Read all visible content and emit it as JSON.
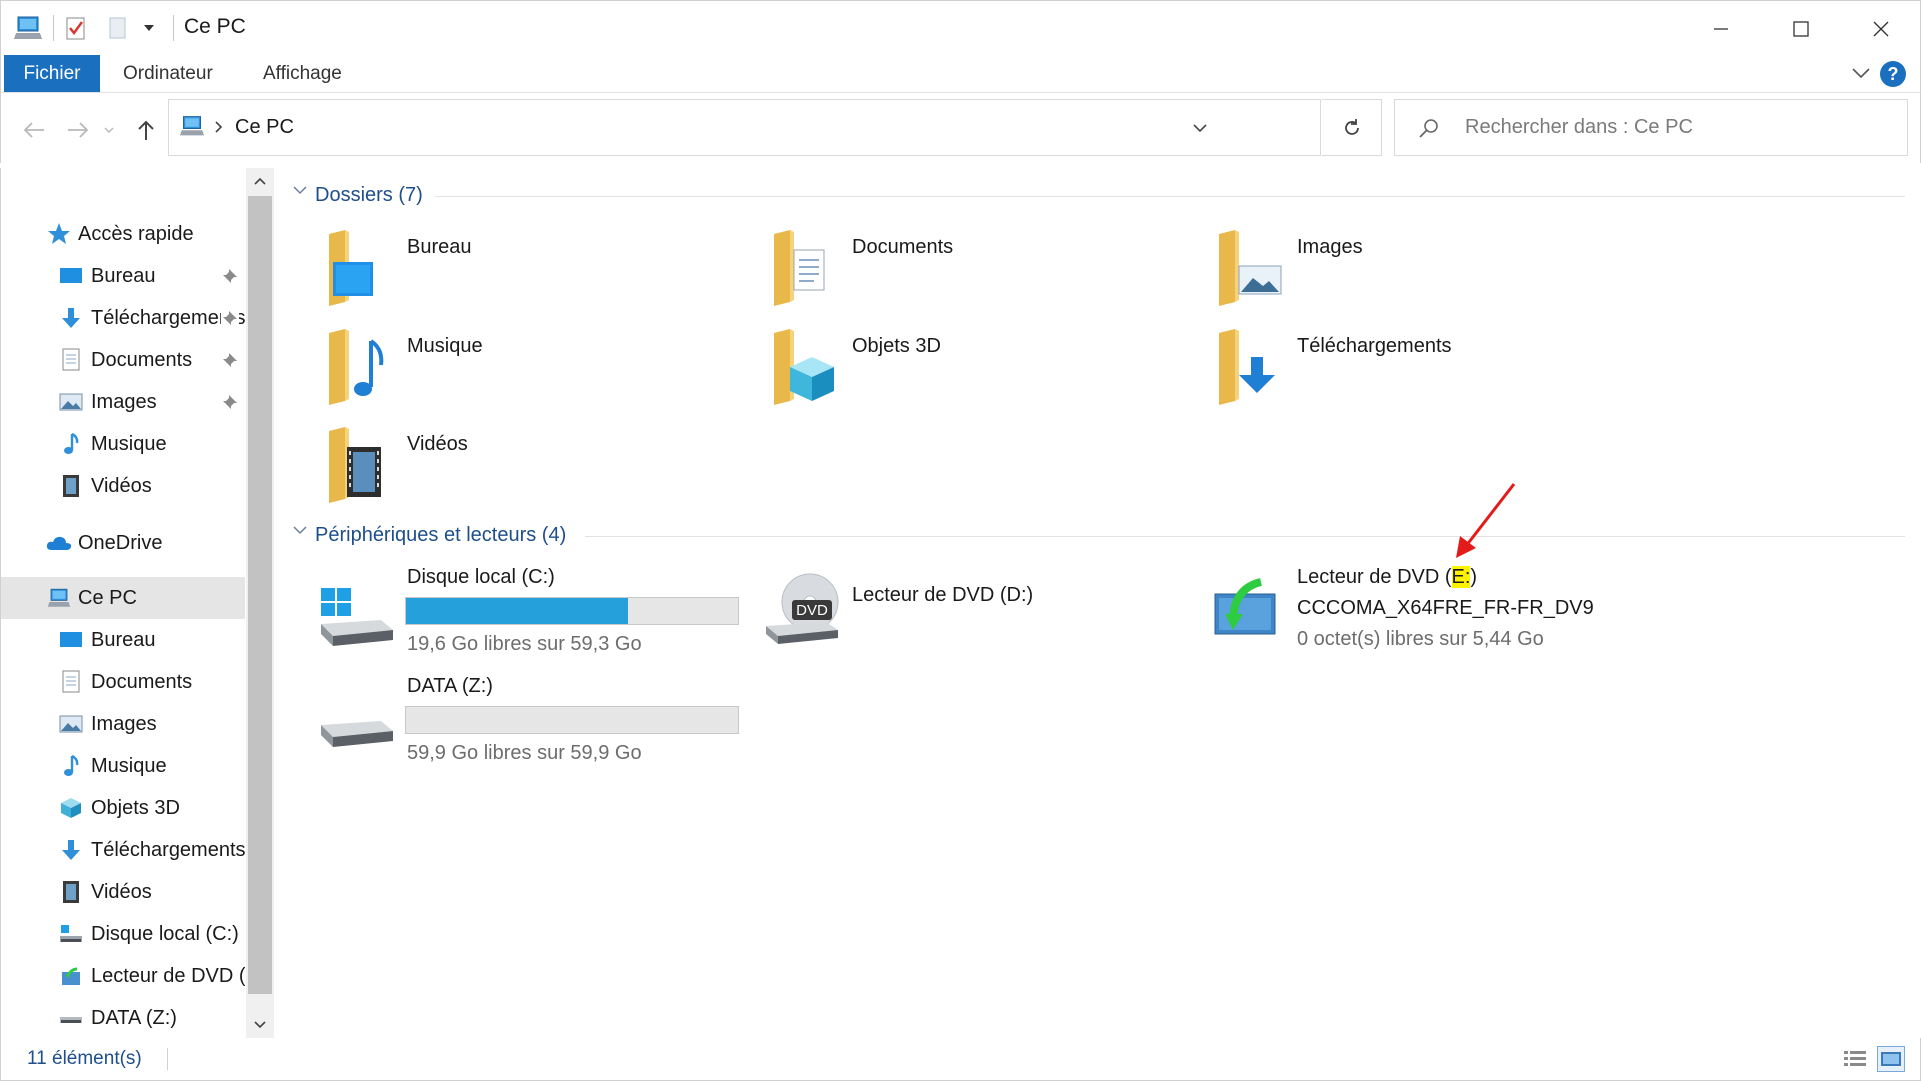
{
  "window": {
    "title": "Ce PC"
  },
  "ribbon": {
    "tabs": [
      {
        "label": "Fichier"
      },
      {
        "label": "Ordinateur"
      },
      {
        "label": "Affichage"
      }
    ],
    "help_label": "?"
  },
  "navigation": {
    "breadcrumb_current": "Ce PC",
    "search_placeholder": "Rechercher dans : Ce PC"
  },
  "sidebar": {
    "quick_access": "Accès rapide",
    "quick_items": [
      {
        "label": "Bureau",
        "icon": "desktop-icon",
        "pinned": true
      },
      {
        "label": "Téléchargements",
        "icon": "download-icon",
        "pinned": true
      },
      {
        "label": "Documents",
        "icon": "document-icon",
        "pinned": true
      },
      {
        "label": "Images",
        "icon": "pictures-icon",
        "pinned": true
      },
      {
        "label": "Musique",
        "icon": "music-icon",
        "pinned": false
      },
      {
        "label": "Vidéos",
        "icon": "video-icon",
        "pinned": false
      }
    ],
    "onedrive": "OneDrive",
    "this_pc": "Ce PC",
    "pc_items": [
      {
        "label": "Bureau",
        "icon": "desktop-icon"
      },
      {
        "label": "Documents",
        "icon": "document-icon"
      },
      {
        "label": "Images",
        "icon": "pictures-icon"
      },
      {
        "label": "Musique",
        "icon": "music-icon"
      },
      {
        "label": "Objets 3D",
        "icon": "cube-icon"
      },
      {
        "label": "Téléchargements",
        "icon": "download-icon"
      },
      {
        "label": "Vidéos",
        "icon": "video-icon"
      },
      {
        "label": "Disque local (C:)",
        "icon": "local-disk-icon"
      },
      {
        "label": "Lecteur de DVD (E:)",
        "icon": "dvd-drive-icon"
      },
      {
        "label": "DATA (Z:)",
        "icon": "drive-icon"
      }
    ]
  },
  "content": {
    "folders_header": "Dossiers (7)",
    "folders": [
      {
        "name": "Bureau",
        "icon": "desktop-folder-icon"
      },
      {
        "name": "Documents",
        "icon": "documents-folder-icon"
      },
      {
        "name": "Images",
        "icon": "pictures-folder-icon"
      },
      {
        "name": "Musique",
        "icon": "music-folder-icon"
      },
      {
        "name": "Objets 3D",
        "icon": "3d-objects-folder-icon"
      },
      {
        "name": "Téléchargements",
        "icon": "downloads-folder-icon"
      },
      {
        "name": "Vidéos",
        "icon": "videos-folder-icon"
      }
    ],
    "devices_header": "Périphériques et lecteurs (4)",
    "drives": [
      {
        "name": "Disque local (C:)",
        "info": "19,6 Go libres sur 59,3 Go",
        "used_fraction": 0.67,
        "icon": "windows-disk-icon"
      },
      {
        "name": "Lecteur de DVD (D:)",
        "icon": "dvd-icon"
      },
      {
        "name_prefix": "Lecteur de DVD (",
        "name_highlight": "E:",
        "name_suffix": ")",
        "label": "CCCOMA_X64FRE_FR-FR_DV9",
        "info": "0 octet(s) libres sur 5,44 Go",
        "icon": "setup-dvd-icon"
      },
      {
        "name": "DATA (Z:)",
        "info": "59,9 Go libres sur 59,9 Go",
        "used_fraction": 0.0,
        "icon": "drive-icon"
      }
    ],
    "annotation_arrow_color": "#e31b1b"
  },
  "status": {
    "item_count": "11 élément(s)"
  },
  "colors": {
    "accent": "#1a6fbf",
    "header_text": "#1e4e8c",
    "bar_fill": "#26a0da",
    "highlight": "#fff200"
  }
}
